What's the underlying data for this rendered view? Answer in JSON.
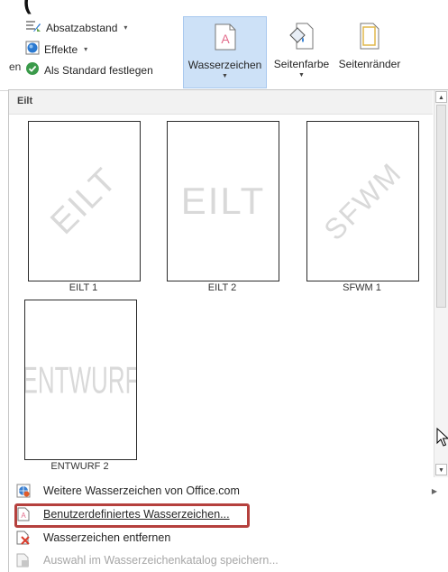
{
  "ribbon": {
    "partial_heading": "(",
    "cut_left_label": "en",
    "paragraph_spacing_label": "Absatzabstand",
    "effects_label": "Effekte",
    "set_default_label": "Als Standard festlegen",
    "watermark_label": "Wasserzeichen",
    "page_color_label": "Seitenfarbe",
    "page_borders_label": "Seitenränder"
  },
  "gallery": {
    "section_header": "Eilt",
    "thumbnails": [
      {
        "label": "EILT 1",
        "watermark_text": "EILT",
        "style": "diagonal"
      },
      {
        "label": "EILT 2",
        "watermark_text": "EILT",
        "style": "horizontal"
      },
      {
        "label": "SFWM 1",
        "watermark_text": "SFWM",
        "style": "diagonal"
      },
      {
        "label": "ENTWURF 2",
        "watermark_text": "ENTWURF",
        "style": "horizontal"
      }
    ]
  },
  "menu": {
    "items": [
      {
        "label": "Weitere Wasserzeichen von Office.com",
        "icon": "office-globe-icon",
        "has_submenu": true
      },
      {
        "label": "Benutzerdefiniertes Wasserzeichen...",
        "icon": "custom-watermark-icon",
        "highlighted": true
      },
      {
        "label": "Wasserzeichen entfernen",
        "icon": "remove-watermark-icon"
      },
      {
        "label": "Auswahl im Wasserzeichenkatalog speichern...",
        "icon": "save-selection-icon",
        "disabled": true
      }
    ]
  },
  "colors": {
    "active_button_bg": "#cde1f7",
    "highlight_border": "#b5403d",
    "watermark_text": "#d9d9d9"
  }
}
